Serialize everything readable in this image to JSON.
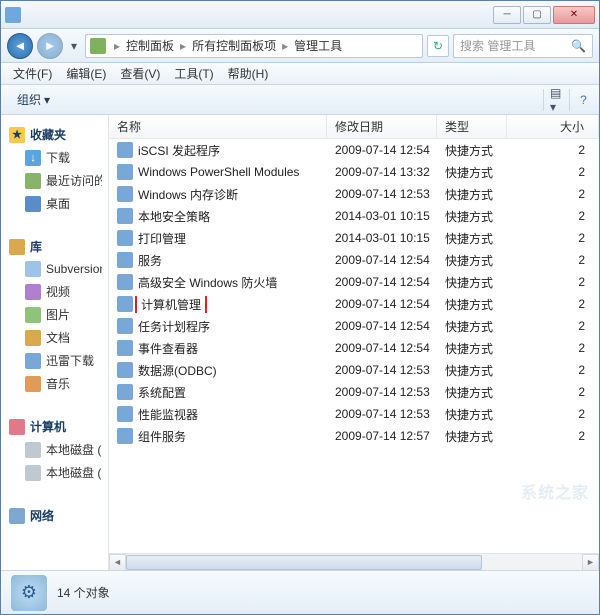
{
  "titlebar": {
    "title": ""
  },
  "breadcrumb": {
    "seg1": "控制面板",
    "seg2": "所有控制面板项",
    "seg3": "管理工具"
  },
  "search": {
    "placeholder": "搜索 管理工具"
  },
  "menu": {
    "file": "文件(F)",
    "edit": "编辑(E)",
    "view": "查看(V)",
    "tools": "工具(T)",
    "help": "帮助(H)"
  },
  "toolbar": {
    "organize": "组织"
  },
  "sidebar": {
    "fav": "收藏夹",
    "fav_items": [
      "下载",
      "最近访问的",
      "桌面"
    ],
    "lib": "库",
    "lib_items": [
      "Subversion",
      "视频",
      "图片",
      "文档",
      "迅雷下载",
      "音乐"
    ],
    "computer": "计算机",
    "computer_items": [
      "本地磁盘 (",
      "本地磁盘 ("
    ],
    "network": "网络"
  },
  "columns": {
    "name": "名称",
    "date": "修改日期",
    "type": "类型",
    "size": "大小"
  },
  "items": [
    {
      "name": "iSCSI 发起程序",
      "date": "2009-07-14 12:54",
      "type": "快捷方式",
      "size": "2"
    },
    {
      "name": "Windows PowerShell Modules",
      "date": "2009-07-14 13:32",
      "type": "快捷方式",
      "size": "2"
    },
    {
      "name": "Windows 内存诊断",
      "date": "2009-07-14 12:53",
      "type": "快捷方式",
      "size": "2"
    },
    {
      "name": "本地安全策略",
      "date": "2014-03-01 10:15",
      "type": "快捷方式",
      "size": "2"
    },
    {
      "name": "打印管理",
      "date": "2014-03-01 10:15",
      "type": "快捷方式",
      "size": "2"
    },
    {
      "name": "服务",
      "date": "2009-07-14 12:54",
      "type": "快捷方式",
      "size": "2"
    },
    {
      "name": "高级安全 Windows 防火墙",
      "date": "2009-07-14 12:54",
      "type": "快捷方式",
      "size": "2"
    },
    {
      "name": "计算机管理",
      "date": "2009-07-14 12:54",
      "type": "快捷方式",
      "size": "2",
      "highlight": true
    },
    {
      "name": "任务计划程序",
      "date": "2009-07-14 12:54",
      "type": "快捷方式",
      "size": "2"
    },
    {
      "name": "事件查看器",
      "date": "2009-07-14 12:54",
      "type": "快捷方式",
      "size": "2"
    },
    {
      "name": "数据源(ODBC)",
      "date": "2009-07-14 12:53",
      "type": "快捷方式",
      "size": "2"
    },
    {
      "name": "系统配置",
      "date": "2009-07-14 12:53",
      "type": "快捷方式",
      "size": "2"
    },
    {
      "name": "性能监视器",
      "date": "2009-07-14 12:53",
      "type": "快捷方式",
      "size": "2"
    },
    {
      "name": "组件服务",
      "date": "2009-07-14 12:57",
      "type": "快捷方式",
      "size": "2"
    }
  ],
  "status": {
    "text": "14 个对象"
  },
  "watermark": "系统之家"
}
